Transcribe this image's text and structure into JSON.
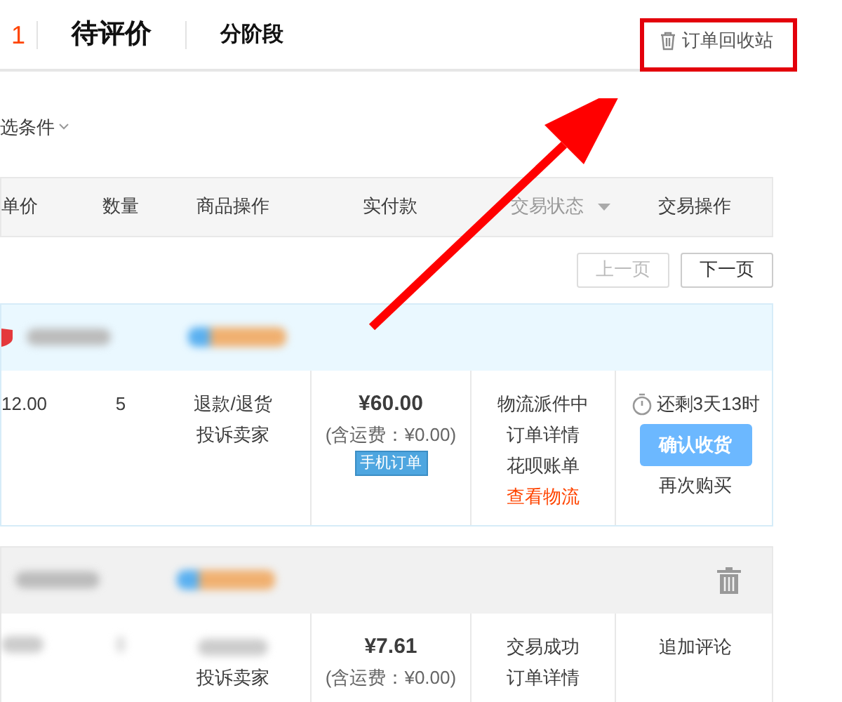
{
  "tab_count_fragment": "1",
  "tabs": [
    {
      "label": "待评价",
      "selected": true
    },
    {
      "label": "分阶段",
      "selected": false
    }
  ],
  "recycle_bin": {
    "label": "订单回收站"
  },
  "filter": {
    "label": "选条件"
  },
  "table": {
    "columns": [
      "单价",
      "数量",
      "商品操作",
      "实付款",
      "交易状态",
      "交易操作"
    ]
  },
  "pagination": [
    {
      "label": "上一页",
      "disabled": true
    },
    {
      "label": "下一页",
      "disabled": false
    }
  ],
  "orders": [
    {
      "highlighted": true,
      "deletable": false,
      "unit_price": "12.00",
      "quantity": "5",
      "item_actions": [
        "退款/退货",
        "投诉卖家"
      ],
      "total": "¥60.00",
      "shipping": "(含运费：¥0.00)",
      "badge": "手机订单",
      "status": [
        {
          "label": "物流派件中",
          "kind": "text"
        },
        {
          "label": "订单详情",
          "kind": "link"
        },
        {
          "label": "花呗账单",
          "kind": "link"
        },
        {
          "label": "查看物流",
          "kind": "alert"
        }
      ],
      "countdown": "还剩3天13时",
      "operations": [
        {
          "label": "确认收货",
          "kind": "primary"
        },
        {
          "label": "再次购买",
          "kind": "link"
        }
      ]
    },
    {
      "highlighted": false,
      "deletable": true,
      "item_actions": [
        "投诉卖家"
      ],
      "total": "¥7.61",
      "shipping": "(含运费：¥0.00)",
      "status": [
        {
          "label": "交易成功",
          "kind": "text"
        },
        {
          "label": "订单详情",
          "kind": "link"
        }
      ],
      "operations": [
        {
          "label": "追加评论",
          "kind": "link"
        }
      ]
    }
  ]
}
